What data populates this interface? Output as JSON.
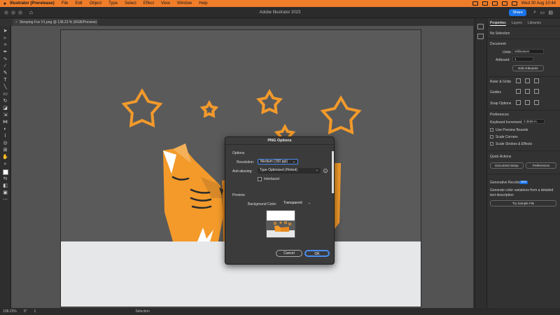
{
  "menubar": {
    "app": "Illustrator (Prerelease)",
    "items": [
      "File",
      "Edit",
      "Object",
      "Type",
      "Select",
      "Effect",
      "View",
      "Window",
      "Help"
    ],
    "clock": "Wed 30 Aug 10:44"
  },
  "appbar": {
    "title": "Adobe Illustrator 2023",
    "share_label": "Share"
  },
  "document": {
    "tab_label": "Sleeping Fox V1.png @ 138.23 % (RGB/Preview)"
  },
  "statusbar": {
    "zoom": "138.23%",
    "rotation": "0°",
    "artboard": "1",
    "tool": "Selection"
  },
  "panel": {
    "tabs": [
      "Properties",
      "Layers",
      "Libraries"
    ],
    "no_selection": "No Selection",
    "document_header": "Document",
    "units_label": "Units:",
    "units_value": "Millimeters",
    "artboard_label": "Artboard:",
    "artboard_value": "1",
    "edit_artboards": "Edit Artboards",
    "ruler_grids": "Ruler & Grids",
    "guides": "Guides",
    "snap_options": "Snap Options",
    "preferences_header": "Preferences",
    "keyboard_increment_label": "Keyboard Increment:",
    "keyboard_increment_value": "0.3528 m",
    "use_preview_bounds": "Use Preview Bounds",
    "scale_corners": "Scale Corners",
    "scale_strokes": "Scale Strokes & Effects",
    "quick_actions": "Quick Actions",
    "document_setup": "Document Setup",
    "preferences_btn": "Preferences",
    "generative_recolor": "Generative Recolor",
    "new_badge": "NEW",
    "recolor_desc_1": "Generate color variations from a detailed",
    "recolor_desc_2": "text description",
    "try_sample": "Try Sample File"
  },
  "dialog": {
    "title": "PNG Options",
    "options_header": "Options",
    "resolution_label": "Resolution:",
    "resolution_value": "Medium (150 ppi)",
    "antialias_label": "Anti-aliasing:",
    "antialias_value": "Type Optimized (Hinted)",
    "interlaced_label": "Interlaced",
    "preview_header": "Preview",
    "bg_label": "Background Color:",
    "bg_value": "Transparent",
    "cancel_label": "Cancel",
    "ok_label": "OK"
  },
  "colors": {
    "menubar": "#ef7d2a",
    "fox_orange": "#f39a2b",
    "star_orange": "#f39a2b",
    "accent_blue": "#1a73e8"
  }
}
